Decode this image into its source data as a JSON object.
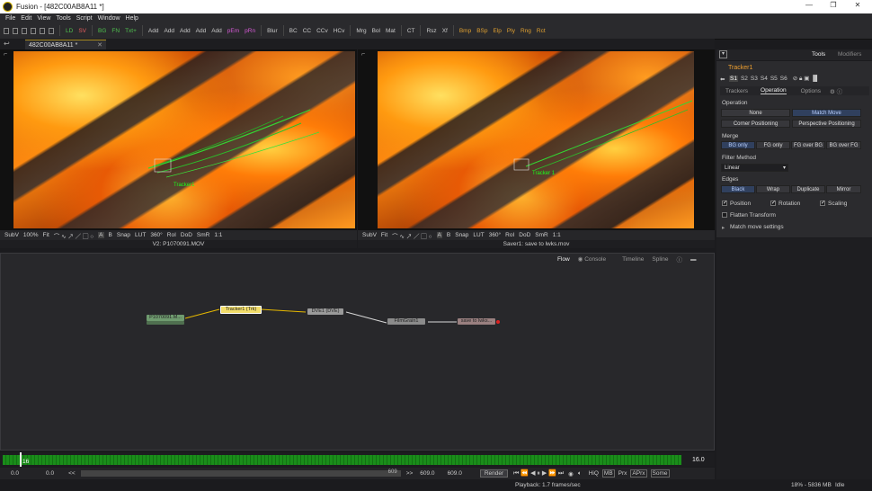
{
  "window": {
    "title": "Fusion - [482C00AB8A11 *]"
  },
  "menu": [
    "File",
    "Edit",
    "View",
    "Tools",
    "Script",
    "Window",
    "Help"
  ],
  "toolbar": {
    "buttons": [
      "LD",
      "SV",
      "BG",
      "FN",
      "Txt+",
      "Add",
      "Add",
      "Add",
      "Add",
      "Add",
      "pEm",
      "pRn",
      "Blur",
      "BC",
      "CC",
      "CCv",
      "HCv",
      "Mrg",
      "Bol",
      "Mat",
      "CT",
      "Rsz",
      "Xf",
      "Bmp",
      "BSp",
      "Elp",
      "Ply",
      "Rng",
      "Rct"
    ],
    "colors": {
      "LD": "#4fc24f",
      "SV": "#e85d5d",
      "BG": "#4fc24f",
      "FN": "#4fc24f",
      "Txt+": "#4fc24f",
      "pEm": "#d65ad6",
      "pRn": "#d65ad6",
      "Bmp": "#e0a030",
      "BSp": "#e0a030",
      "Elp": "#e0a030",
      "Ply": "#e0a030",
      "Rng": "#e0a030",
      "Rct": "#e0a030"
    }
  },
  "doc_tab": "482C00AB8A11 *",
  "viewer_left": {
    "toolbar": [
      "SubV",
      "100%",
      "Fit",
      "Snap",
      "LUT",
      "360°",
      "RoI",
      "DoD",
      "SmR",
      "1:1"
    ],
    "overlay_label": "Tracker1",
    "label": "V2: P1070091.MOV"
  },
  "viewer_right": {
    "toolbar": [
      "SubV",
      "Fit",
      "Snap",
      "LUT",
      "360°",
      "RoI",
      "DoD",
      "SmR",
      "1:1"
    ],
    "overlay_label": "Tracker 1",
    "label": "Saver1: save to lwks.mov"
  },
  "flow": {
    "tabs": [
      "Flow",
      "Console",
      "Timeline",
      "Spline"
    ],
    "nodes": {
      "loader": "P1070091.M...",
      "tracker": "Tracker1 (Trk)",
      "dve": "DVE1 (DVE)",
      "grain": "FilmGrain1",
      "saver": "save to lwks..."
    }
  },
  "timeline": {
    "start_marker": "16",
    "end_value": "16.0"
  },
  "transport": {
    "current": "0.0",
    "start": "0.0",
    "back": "<<",
    "end_slider": "609",
    "fwd": ">>",
    "render_end": "609.0",
    "global_end": "609.0",
    "render": "Render",
    "hiq": "HiQ",
    "mb": "MB",
    "prx": "Prx",
    "aprx": "APrx",
    "some": "Some"
  },
  "status": {
    "playback": "Playback: 1.7 frames/sec",
    "memory": "18% - 5836 MB",
    "state": "Idle"
  },
  "inspector": {
    "tabs": [
      "Tools",
      "Modifiers"
    ],
    "tool_name": "Tracker1",
    "sets": [
      "S1",
      "S2",
      "S3",
      "S4",
      "S5",
      "S6"
    ],
    "subtabs": [
      "Trackers",
      "Operation",
      "Options"
    ],
    "operation_label": "Operation",
    "operation_opts": [
      "None",
      "Match Move",
      "Corner Positioning",
      "Perspective Positioning"
    ],
    "merge_label": "Merge",
    "merge_opts": [
      "BG only",
      "FG only",
      "FG over BG",
      "BG over FG"
    ],
    "filter_label": "Filter Method",
    "filter_value": "Linear",
    "edges_label": "Edges",
    "edges_opts": [
      "Black",
      "Wrap",
      "Duplicate",
      "Mirror"
    ],
    "checks": {
      "position": "Position",
      "rotation": "Rotation",
      "scaling": "Scaling",
      "flatten": "Flatten Transform",
      "match_settings": "Match move settings"
    }
  }
}
